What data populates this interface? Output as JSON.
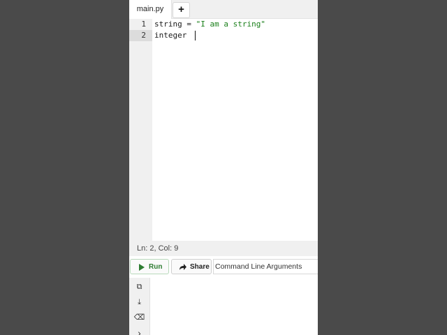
{
  "tabs": {
    "file_name": "main.py",
    "add_label": "+"
  },
  "editor": {
    "line_numbers": [
      "1",
      "2"
    ],
    "lines": [
      {
        "prefix": "string = ",
        "string_literal": "\"I am a string\""
      },
      {
        "prefix": "integer ",
        "string_literal": ""
      }
    ]
  },
  "status": {
    "position": "Ln: 2,  Col: 9"
  },
  "toolbar": {
    "run_label": "Run",
    "run_icon": "play-icon",
    "share_label": "Share",
    "share_icon": "share-arrow-icon",
    "args_placeholder": "Command Line Arguments"
  },
  "side_tools": [
    {
      "icon": "copy-icon",
      "glyph": "⧉"
    },
    {
      "icon": "download-icon",
      "glyph": "⤓"
    },
    {
      "icon": "eraser-icon",
      "glyph": "⌫"
    },
    {
      "icon": "chevron-right-icon",
      "glyph": "›"
    }
  ],
  "colors": {
    "run_green": "#2e7d32",
    "string_green": "#1a7f1a",
    "background": "#4a4a4a"
  }
}
